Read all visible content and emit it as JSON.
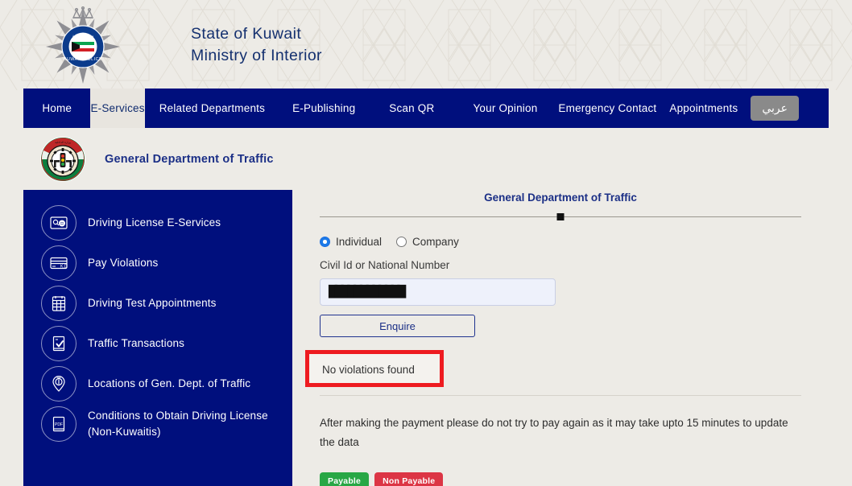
{
  "header": {
    "crest_alt": "kuwait-police-crest",
    "title_line1": "State of Kuwait",
    "title_line2": "Ministry of Interior"
  },
  "nav": {
    "items": [
      {
        "label": "Home",
        "active": false
      },
      {
        "label": "E-Services",
        "active": true
      },
      {
        "label": "Related Departments",
        "active": false
      },
      {
        "label": "E-Publishing",
        "active": false
      },
      {
        "label": "Scan QR",
        "active": false
      },
      {
        "label": "Your Opinion",
        "active": false
      },
      {
        "label": "Emergency Contact",
        "active": false
      },
      {
        "label": "Appointments",
        "active": false
      }
    ],
    "language_button": "عربي",
    "bar_color": "#000f7d",
    "active_bg": "#e8e5df",
    "active_text": "#0f2b6e"
  },
  "subbrand": {
    "logo_alt": "general-department-of-traffic-logo",
    "title": "General Department of Traffic"
  },
  "sidebar": {
    "background": "#000f7d",
    "items": [
      {
        "label": "Driving License E-Services",
        "icon": "license-card-icon"
      },
      {
        "label": "Pay Violations",
        "icon": "payment-card-kd-icon"
      },
      {
        "label": "Driving Test Appointments",
        "icon": "calendar-icon"
      },
      {
        "label": "Traffic Transactions",
        "icon": "document-check-icon"
      },
      {
        "label": " Locations of Gen. Dept. of Traffic",
        "icon": "map-pin-icon"
      },
      {
        "label": "Conditions to Obtain Driving License (Non-Kuwaitis)",
        "icon": "pdf-document-icon"
      }
    ]
  },
  "main": {
    "panel_title": "General Department of Traffic",
    "radio": {
      "individual_label": "Individual",
      "company_label": "Company",
      "selected": "Individual"
    },
    "civil_id": {
      "label": "Civil Id or National Number",
      "value": "████████████",
      "placeholder": "",
      "redacted": true
    },
    "enquire_button": "Enquire",
    "result_message": "No violations found",
    "result_highlight_color": "#ee1b20",
    "note": "After making the payment please do not try to pay again as it may take upto 15 minutes to update the data",
    "legend": [
      {
        "label": "Payable",
        "color": "#28a745"
      },
      {
        "label": "Non Payable",
        "color": "#dc3545"
      }
    ]
  }
}
